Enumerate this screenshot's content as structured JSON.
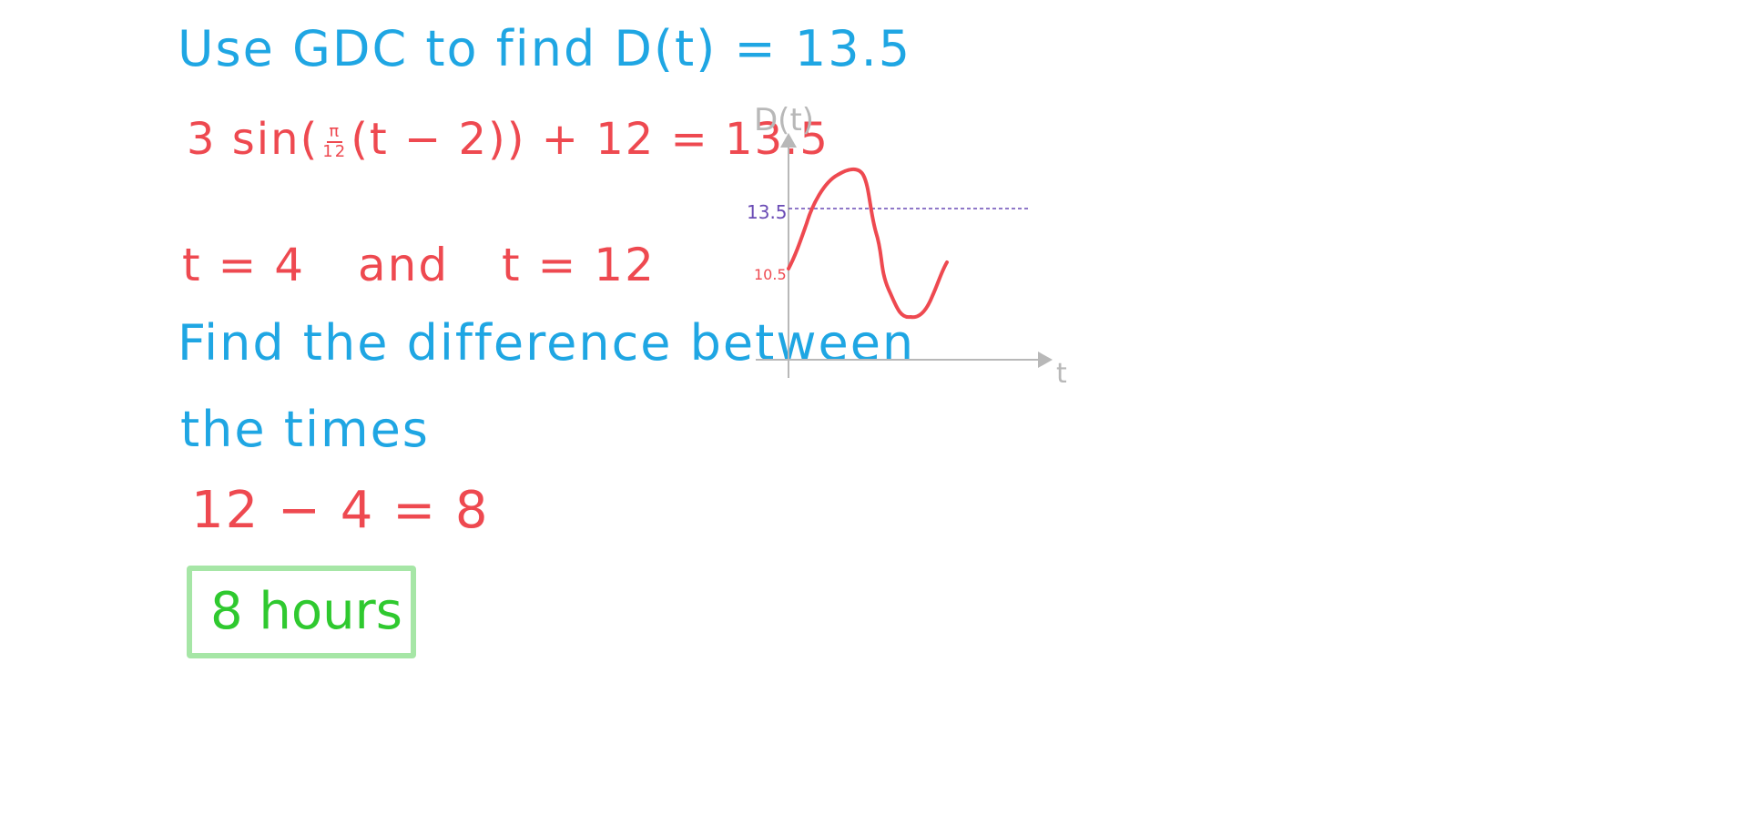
{
  "steps": {
    "instruction_1": "Use GDC to find D(t) = 13.5",
    "equation": {
      "prefix": "3 sin",
      "frac_num": "π",
      "frac_den": "12",
      "suffix": "(t − 2)) + 12 = 13.5",
      "open_paren": "("
    },
    "solutions": {
      "first": "t = 4",
      "connector": "and",
      "second": "t = 12"
    },
    "instruction_2_line1": "Find the difference between",
    "instruction_2_line2": "the times",
    "calculation": "12 − 4 = 8",
    "answer": "8 hours"
  },
  "graph": {
    "y_axis_label": "D(t)",
    "x_axis_label": "t",
    "level_label": "13.5",
    "intercept_label": "10.5"
  },
  "colors": {
    "instruction": "#1fa6e3",
    "working": "#ee4950",
    "answer": "#2fc92f",
    "answer_box": "#a6e6a6",
    "level_line": "#6a4bb5",
    "axes": "#b8b8b8"
  }
}
